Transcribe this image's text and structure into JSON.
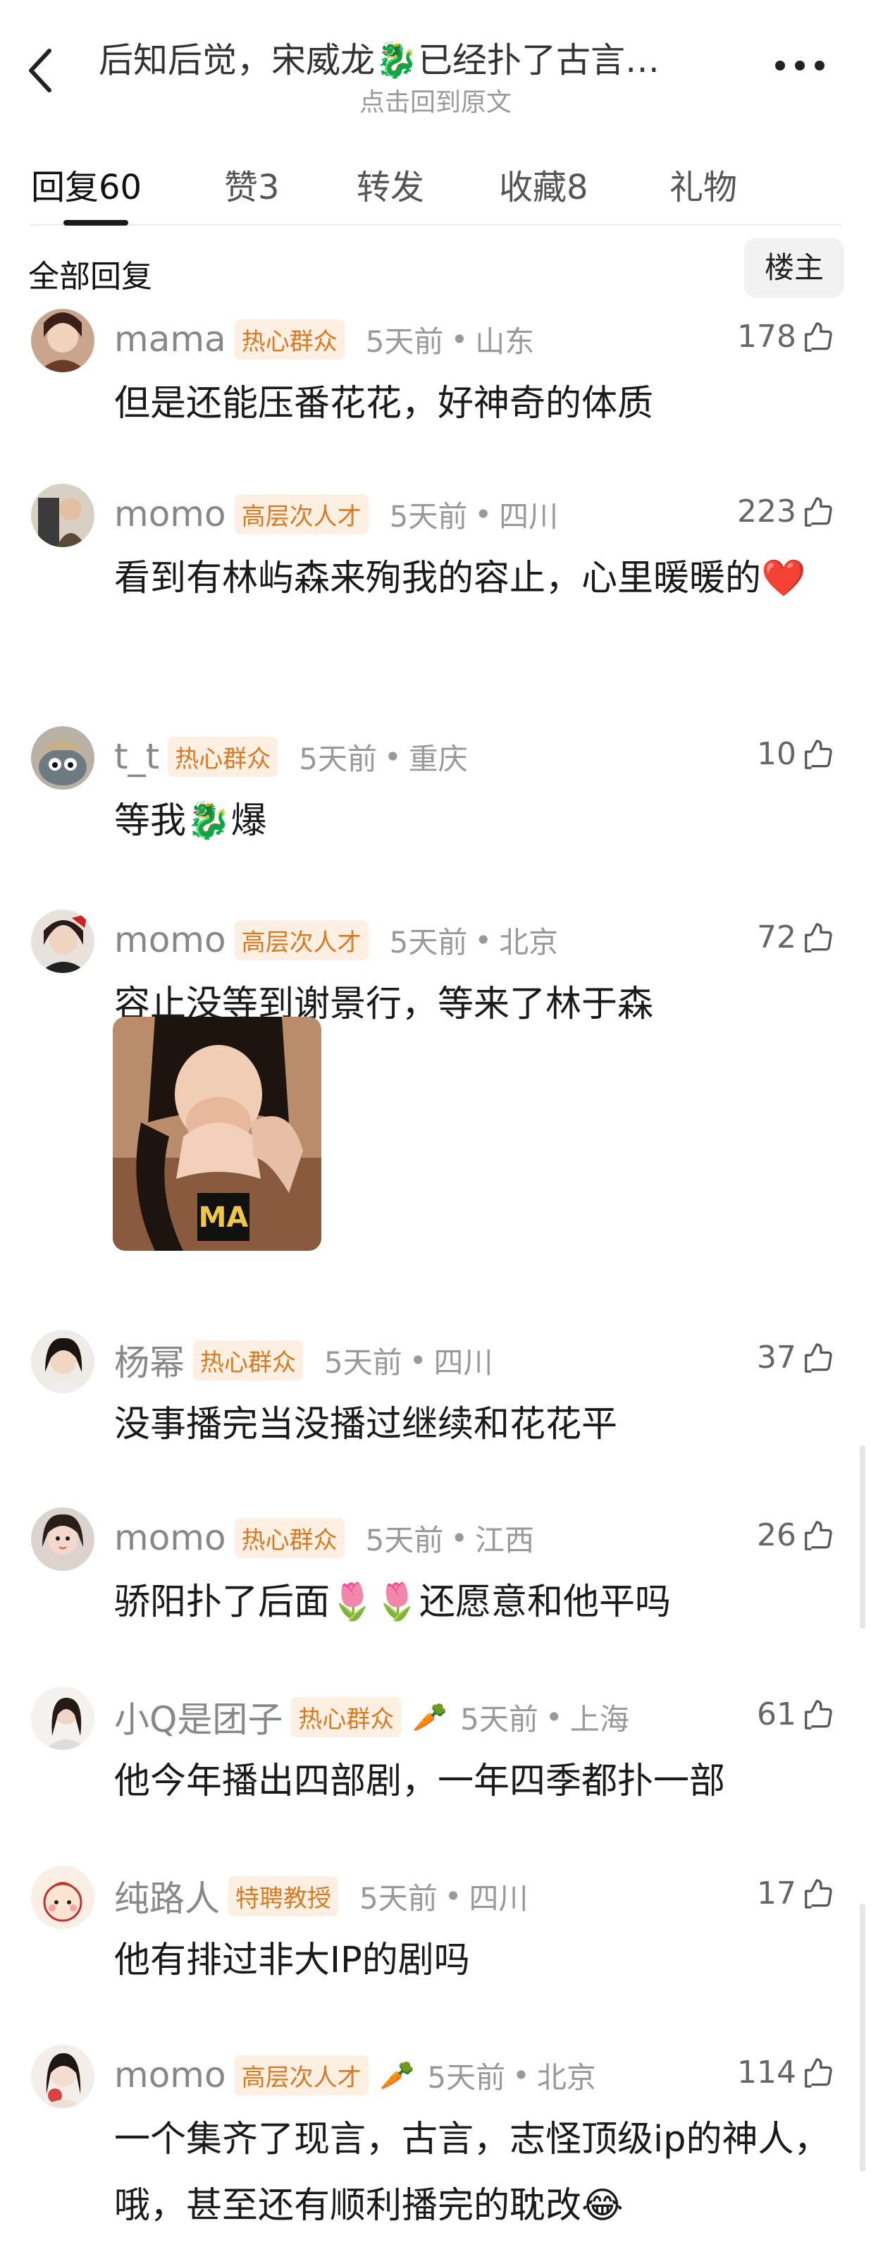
{
  "header": {
    "title": "后知后觉，宋威龙🐉已经扑了古言…",
    "subtitle": "点击回到原文"
  },
  "tabs": [
    {
      "label": "回复",
      "count": "60"
    },
    {
      "label": "赞",
      "count": "3"
    },
    {
      "label": "转发",
      "count": ""
    },
    {
      "label": "收藏",
      "count": "8"
    },
    {
      "label": "礼物",
      "count": ""
    }
  ],
  "section": {
    "title": "全部回复",
    "filter_label": "楼主"
  },
  "comments": [
    {
      "username": "mama",
      "badge": "热心群众",
      "time": "5天前",
      "location": "山东",
      "likes": "178",
      "text": "但是还能压番花花，好神奇的体质"
    },
    {
      "username": "momo",
      "badge": "高层次人才",
      "time": "5天前",
      "location": "四川",
      "likes": "223",
      "text": "看到有林屿森来殉我的容止，心里暖暖的❤️"
    },
    {
      "username": "t_t",
      "badge": "热心群众",
      "time": "5天前",
      "location": "重庆",
      "likes": "10",
      "text": "等我🐉爆"
    },
    {
      "username": "momo",
      "badge": "高层次人才",
      "time": "5天前",
      "location": "北京",
      "likes": "72",
      "text": "容止没等到谢景行，等来了林于森",
      "image_text": "MA"
    },
    {
      "username": "杨幂",
      "badge": "热心群众",
      "time": "5天前",
      "location": "四川",
      "likes": "37",
      "text": "没事播完当没播过继续和花花平"
    },
    {
      "username": "momo",
      "badge": "热心群众",
      "time": "5天前",
      "location": "江西",
      "likes": "26",
      "text": "骄阳扑了后面🌷🌷还愿意和他平吗"
    },
    {
      "username": "小Q是团子",
      "badge": "热心群众",
      "emoji": "🥕",
      "time": "5天前",
      "location": "上海",
      "likes": "61",
      "text": "他今年播出四部剧，一年四季都扑一部"
    },
    {
      "username": "纯路人",
      "badge": "特聘教授",
      "time": "5天前",
      "location": "四川",
      "likes": "17",
      "text": "他有排过非大IP的剧吗"
    },
    {
      "username": "momo",
      "badge": "高层次人才",
      "emoji": "🥕",
      "time": "5天前",
      "location": "北京",
      "likes": "114",
      "text": "一个集齐了现言，古言，志怪顶级ip的神人，哦，甚至还有顺利播完的耽改😂"
    }
  ],
  "icons": {
    "back": "chevron-left-icon",
    "more": "more-dots-icon",
    "like": "thumbs-up-icon"
  },
  "colors": {
    "badge_text": "#d67a26",
    "badge_bg": "#fdf0e2",
    "username": "#888888",
    "meta": "#999999"
  }
}
